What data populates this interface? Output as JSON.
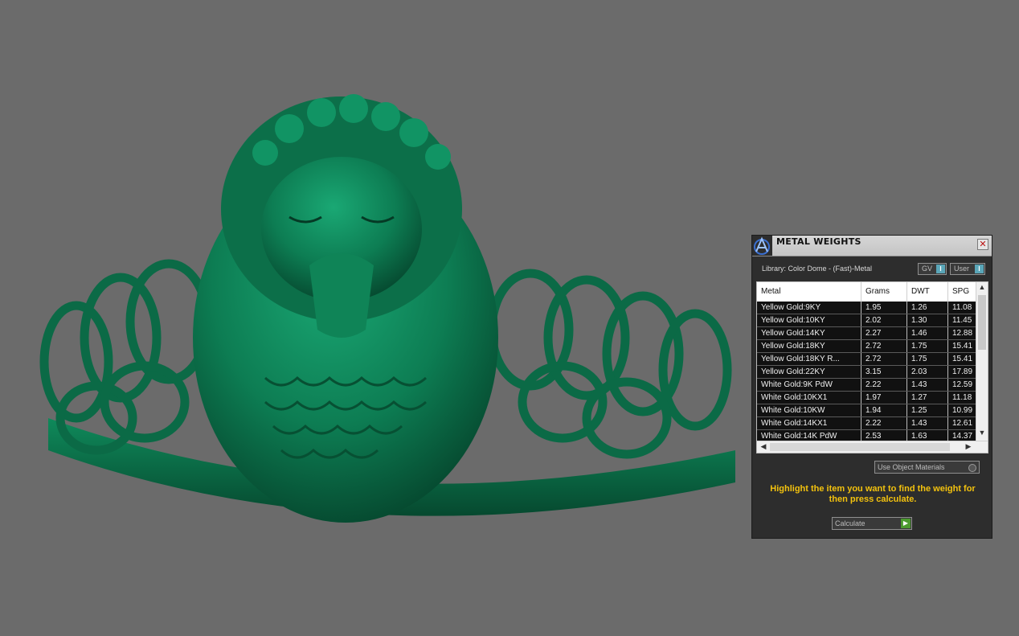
{
  "panel": {
    "title": "METAL WEIGHTS",
    "close_glyph": "✕",
    "library_label": "Library: Color Dome - (Fast)-Metal",
    "toggle_gv_label": "GV",
    "toggle_user_label": "User",
    "toggle_indicator": "I",
    "use_object_materials_label": "Use Object Materials",
    "hint": "Highlight the item you want to find the weight for then press calculate.",
    "calculate_label": "Calculate",
    "accent_hint_color": "#f3c20e"
  },
  "table": {
    "columns": [
      "Metal",
      "Grams",
      "DWT",
      "SPG"
    ],
    "rows": [
      [
        "Yellow Gold:9KY",
        "1.95",
        "1.26",
        "11.08"
      ],
      [
        "Yellow Gold:10KY",
        "2.02",
        "1.30",
        "11.45"
      ],
      [
        "Yellow Gold:14KY",
        "2.27",
        "1.46",
        "12.88"
      ],
      [
        "Yellow Gold:18KY",
        "2.72",
        "1.75",
        "15.41"
      ],
      [
        "Yellow Gold:18KY R...",
        "2.72",
        "1.75",
        "15.41"
      ],
      [
        "Yellow Gold:22KY",
        "3.15",
        "2.03",
        "17.89"
      ],
      [
        "White Gold:9K PdW",
        "2.22",
        "1.43",
        "12.59"
      ],
      [
        "White Gold:10KX1",
        "1.97",
        "1.27",
        "11.18"
      ],
      [
        "White Gold:10KW",
        "1.94",
        "1.25",
        "10.99"
      ],
      [
        "White Gold:14KX1",
        "2.22",
        "1.43",
        "12.61"
      ],
      [
        "White Gold:14K PdW",
        "2.53",
        "1.63",
        "14.37"
      ]
    ]
  },
  "icons": {
    "app_logo": "a-logo-icon",
    "scroll_up": "▲",
    "scroll_down": "▼",
    "scroll_left": "◀",
    "scroll_right": "▶",
    "play": "▶"
  },
  "colors": {
    "viewport_bg": "#6b6b6b",
    "ring_green": "#0f7a52"
  }
}
